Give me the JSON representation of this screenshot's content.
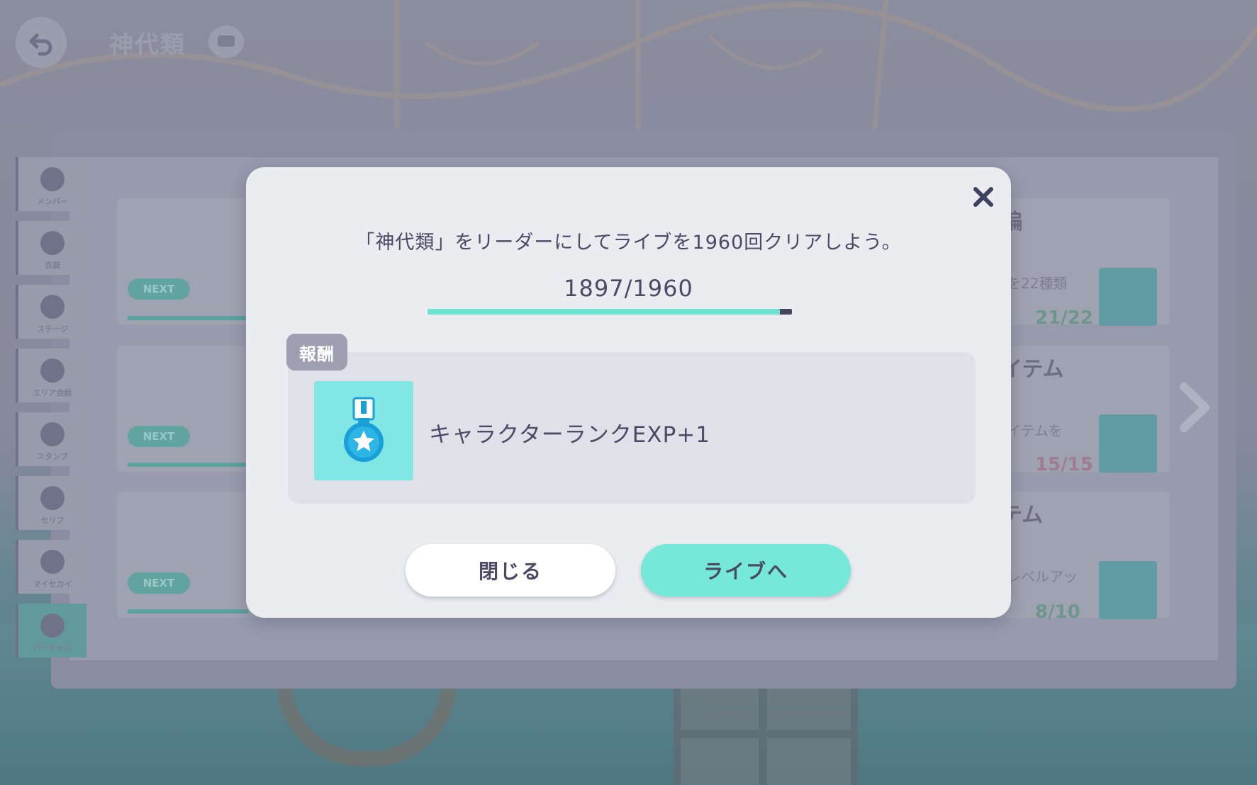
{
  "header": {
    "title": "神代類"
  },
  "background": {
    "side_tabs": [
      "メンバー",
      "衣装",
      "ステージ",
      "エリア会話",
      "スタンプ",
      "セリフ",
      "マイセカイ",
      "バーチャル"
    ],
    "next_label": "NEXT",
    "right_titles": [
      "編",
      "イテム",
      "テム"
    ],
    "right_subs": [
      "を22種類",
      "イテムを",
      "レベルアッ"
    ],
    "counts": [
      "21/22",
      "15/15",
      "8/10"
    ]
  },
  "modal": {
    "mission_text": "「神代類」をリーダーにしてライブを1960回クリアしよう。",
    "progress": {
      "current": 1897,
      "total": 1960,
      "text": "1897/1960"
    },
    "reward_tag": "報酬",
    "reward": {
      "icon": "medal-icon",
      "label": "キャラクターランクEXP+1"
    },
    "close_button": "閉じる",
    "live_button": "ライブへ"
  },
  "colors": {
    "accent": "#76e8d9",
    "progress_fill": "#6fe3d2",
    "text": "#4a4a66",
    "modal_bg": "#ebecf0"
  }
}
